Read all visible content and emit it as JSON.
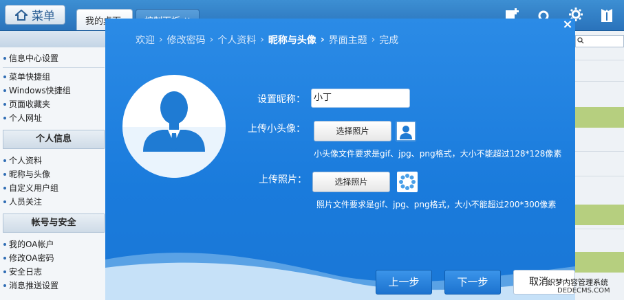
{
  "topbar": {
    "menu_label": "菜单",
    "tabs": [
      {
        "label": "我的桌面"
      },
      {
        "label": "控制面板",
        "close": "×"
      }
    ]
  },
  "sidebar": {
    "group1_items": [
      "信息中心设置",
      "菜单快捷组",
      "Windows快捷组",
      "页面收藏夹",
      "个人网址"
    ],
    "group2_title": "个人信息",
    "group2_items": [
      "个人资料",
      "昵称与头像",
      "自定义用户组",
      "人员关注"
    ],
    "group3_title": "帐号与安全",
    "group3_items": [
      "我的OA帐户",
      "修改OA密码",
      "安全日志",
      "消息推送设置"
    ]
  },
  "modal": {
    "close": "×",
    "breadcrumb": [
      {
        "label": "欢迎"
      },
      {
        "label": "修改密码"
      },
      {
        "label": "个人资料"
      },
      {
        "label": "昵称与头像",
        "active": true
      },
      {
        "label": "界面主题"
      },
      {
        "label": "完成"
      }
    ],
    "nickname_label": "设置昵称：",
    "nickname_value": "小丁",
    "small_avatar_label": "上传小头像：",
    "choose_photo_1": "选择照片",
    "small_avatar_hint": "小头像文件要求是gif、jpg、png格式，大小不能超过128*128像素",
    "photo_label": "上传照片：",
    "choose_photo_2": "选择照片",
    "photo_hint": "照片文件要求是gif、jpg、png格式，大小不能超过200*300像素",
    "prev_button": "上一步",
    "next_button": "下一步",
    "cancel_button": "取消"
  },
  "watermark": {
    "line1": "织梦内容管理系统",
    "line2": "DEDECMS.COM"
  },
  "colors": {
    "accent": "#1a7bdc",
    "topbar": "#2a73bb",
    "sidebar_bullet": "#2f6db4",
    "green_row": "#b6cf7f"
  }
}
